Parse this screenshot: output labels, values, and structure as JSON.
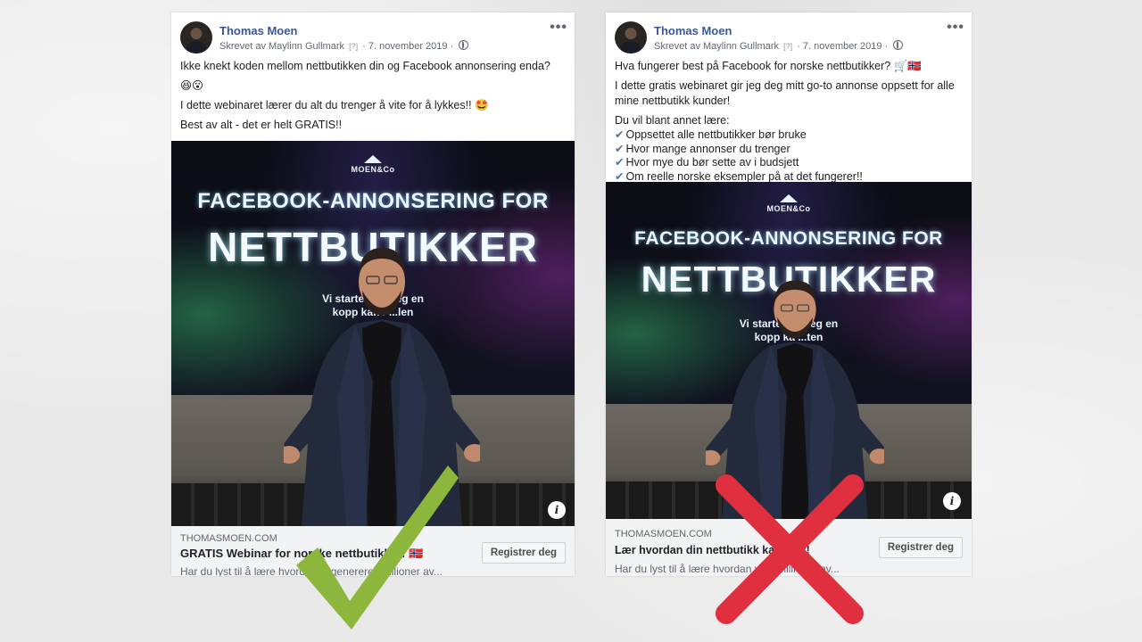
{
  "posts": [
    {
      "author": "Thomas Moen",
      "meta_prefix": "Skrevet av Maylinn Gullmark",
      "meta_q": "[?]",
      "meta_date": "· 7. november 2019 ·",
      "more": "•••",
      "paragraphs": [
        "Ikke knekt koden mellom nettbutikken din og Facebook annonsering enda?",
        "😆😮",
        "I dette webinaret lærer du alt du trenger å vite for å lykkes!! 🤩",
        "Best av alt - det er helt GRATIS!!"
      ],
      "image": {
        "logo": "MOEN&Co",
        "headline1": "FACEBOOK-ANNONSERING FOR",
        "headline2": "NETTBUTIKKER",
        "subline1": "Vi starter 09.          deg en",
        "subline2": "kopp kaffe          ...len"
      },
      "info_icon": "i",
      "link": {
        "domain": "THOMASMOEN.COM",
        "title": "GRATIS Webinar for norske nettbutikker! 🇳🇴",
        "description": "Har du lyst til å lære hvordan vi genererer millioner av...",
        "cta": "Registrer deg"
      }
    },
    {
      "author": "Thomas Moen",
      "meta_prefix": "Skrevet av Maylinn Gullmark",
      "meta_q": "[?]",
      "meta_date": "· 7. november 2019 ·",
      "more": "•••",
      "intro": "Hva fungerer best på Facebook for norske nettbutikker? 🛒🇳🇴",
      "paragraph2": "I dette gratis webinaret gir jeg deg mitt go-to annonse oppsett for alle mine nettbutikk kunder!",
      "list_title": "Du vil blant annet lære:",
      "check_glyph": "✔",
      "list": [
        "Oppsettet alle nettbutikker bør bruke",
        "Hvor mange annonser du trenger",
        "Hvor mye du bør sette av i budsjett",
        "Om reelle norske eksempler på at det fungerer!!"
      ],
      "image": {
        "logo": "MOEN&Co",
        "headline1": "FACEBOOK-ANNONSERING FOR",
        "headline2": "NETTBUTIKKER",
        "subline1": "Vi starter 09          deg en",
        "subline2": "kopp ka          ...ten"
      },
      "info_icon": "i",
      "link": {
        "domain": "THOMASMOEN.COM",
        "title": "Lær hvordan din nettbutikk kan ...es!",
        "description": "Har du lyst til å lære hvordan vi ... millioner av...",
        "cta": "Registrer deg"
      }
    }
  ],
  "marks": {
    "good": {
      "icon": "checkmark-icon",
      "color": "#8cb63c"
    },
    "bad": {
      "icon": "cross-icon",
      "color": "#e0303f"
    }
  }
}
